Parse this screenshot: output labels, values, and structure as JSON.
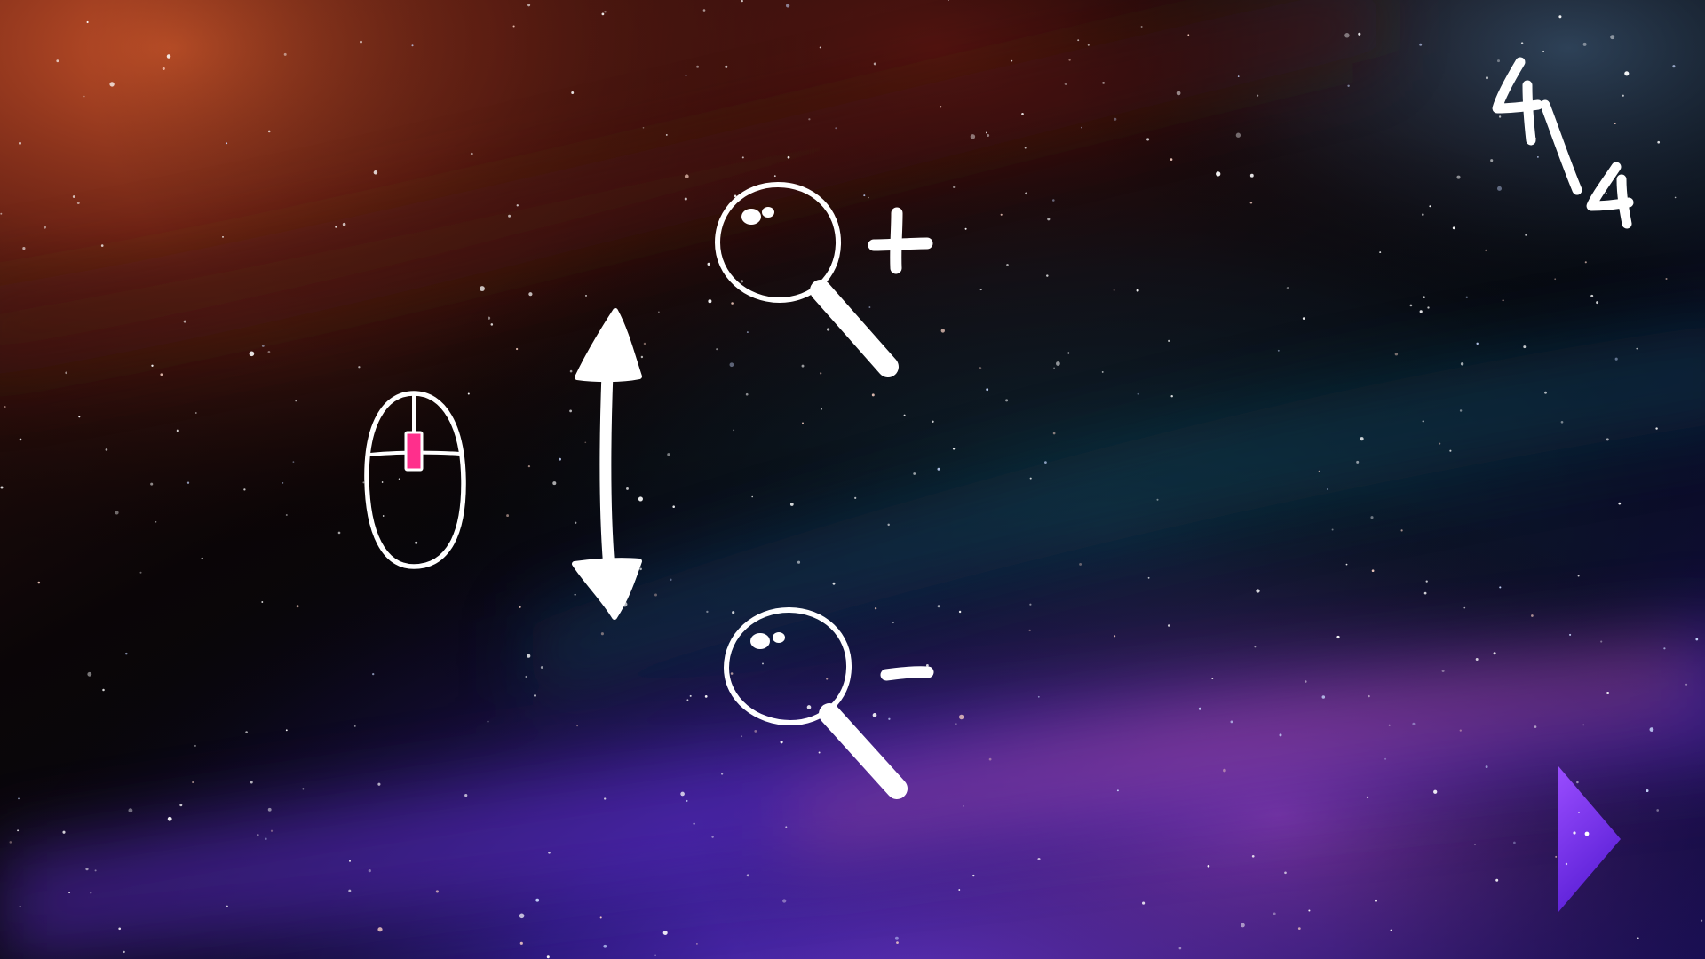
{
  "page_counter": {
    "current": "4",
    "separator": "/",
    "total": "4"
  },
  "zoom_in_label": "+",
  "zoom_out_label": "-",
  "icons": {
    "mouse": "mouse-icon",
    "scroll_wheel": "scroll-wheel-icon",
    "scroll_arrow": "vertical-double-arrow-icon",
    "zoom_in": "magnifier-zoom-in-icon",
    "zoom_out": "magnifier-zoom-out-icon",
    "next": "play-triangle-icon"
  },
  "colors": {
    "scroll_wheel": "#ff2f8c",
    "next_button_top": "#9a4dff",
    "next_button_bottom": "#5a1fd6",
    "ink": "#ffffff"
  }
}
